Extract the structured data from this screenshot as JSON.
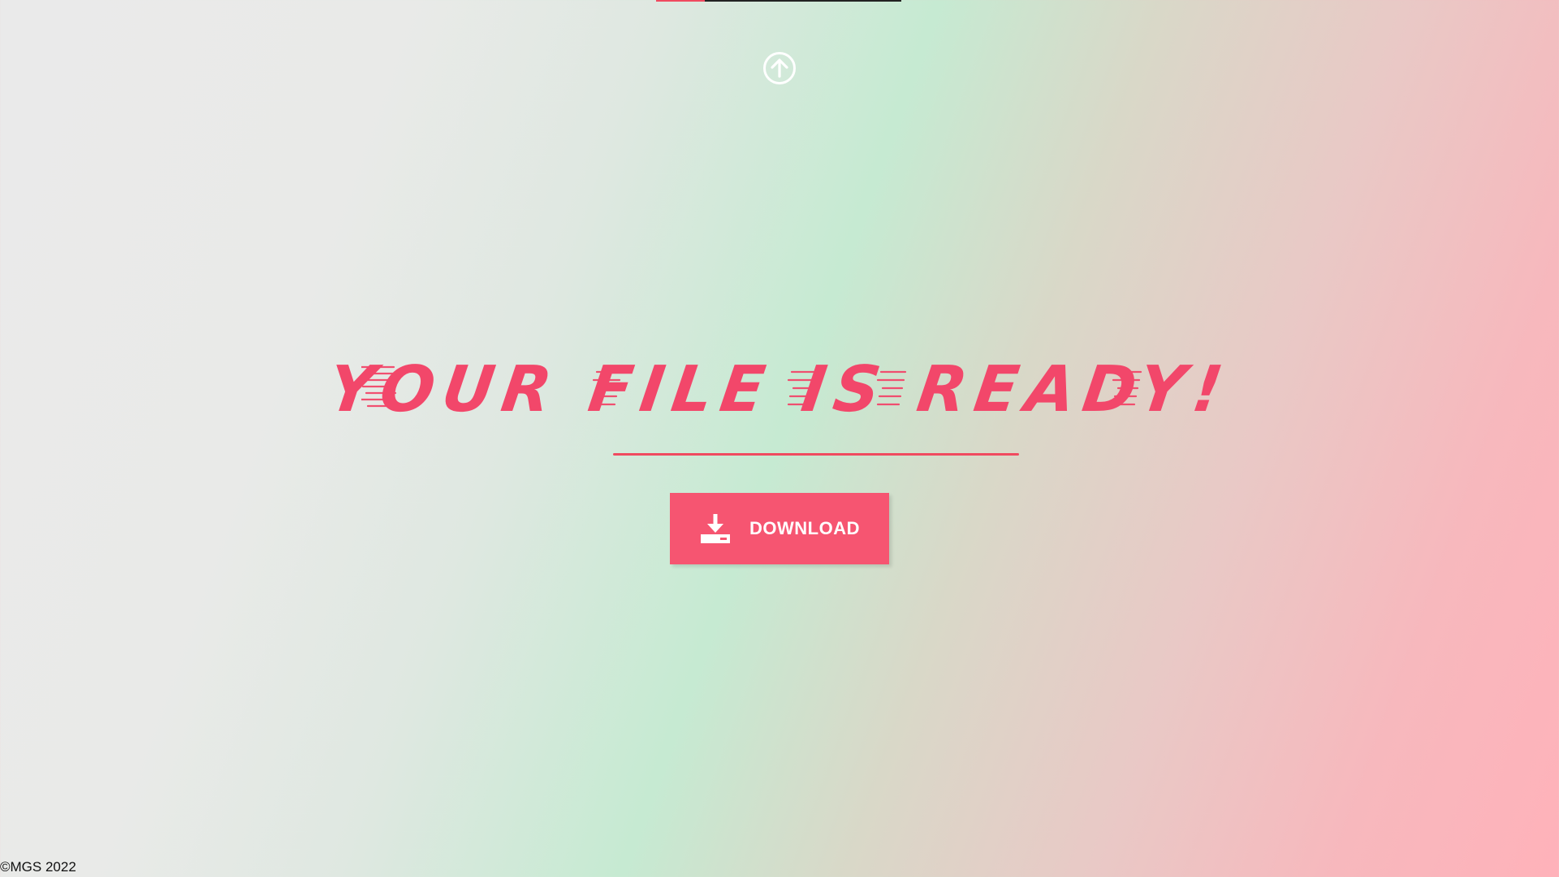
{
  "header": {
    "upload_icon": "circle-arrow-up-icon",
    "progress_fill_fraction": 0.2
  },
  "main": {
    "headline": "YOUR FILE IS READY!",
    "download_button": {
      "label": "DOWNLOAD",
      "icon": "download-icon"
    }
  },
  "footer": {
    "copyright": "©MGS 2022"
  },
  "colors": {
    "accent": "#f04a5f",
    "button_bg": "#f65571",
    "text_light": "#ffffff"
  }
}
